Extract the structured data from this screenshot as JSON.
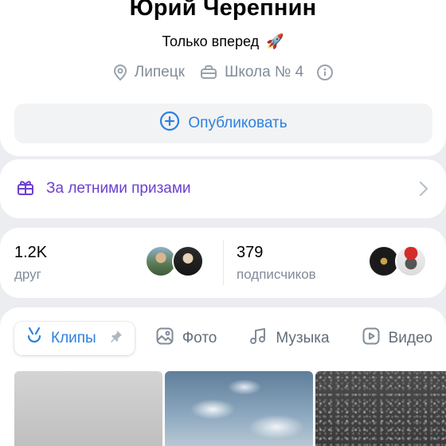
{
  "profile": {
    "name": "Юрий Черепнин",
    "status": "Только вперед",
    "status_emoji": "🚀",
    "city": "Липецк",
    "school": "Школа № 4",
    "publish_label": "Опубликовать"
  },
  "prizes": {
    "label": "За летними призами"
  },
  "stats": {
    "friends_count": "1.2K",
    "friends_label": "друг",
    "followers_count": "379",
    "followers_label": "подписчиков"
  },
  "tabs": [
    {
      "label": "Клипы",
      "icon": "clips-icon",
      "active": true,
      "pinned": true
    },
    {
      "label": "Фото",
      "icon": "photo-icon"
    },
    {
      "label": "Музыка",
      "icon": "music-icon"
    },
    {
      "label": "Видео",
      "icon": "video-icon"
    }
  ],
  "colors": {
    "accent": "#2d81e0",
    "prize": "#6c3fd1",
    "secondary_text": "#818c99",
    "background": "#ebedf0"
  }
}
